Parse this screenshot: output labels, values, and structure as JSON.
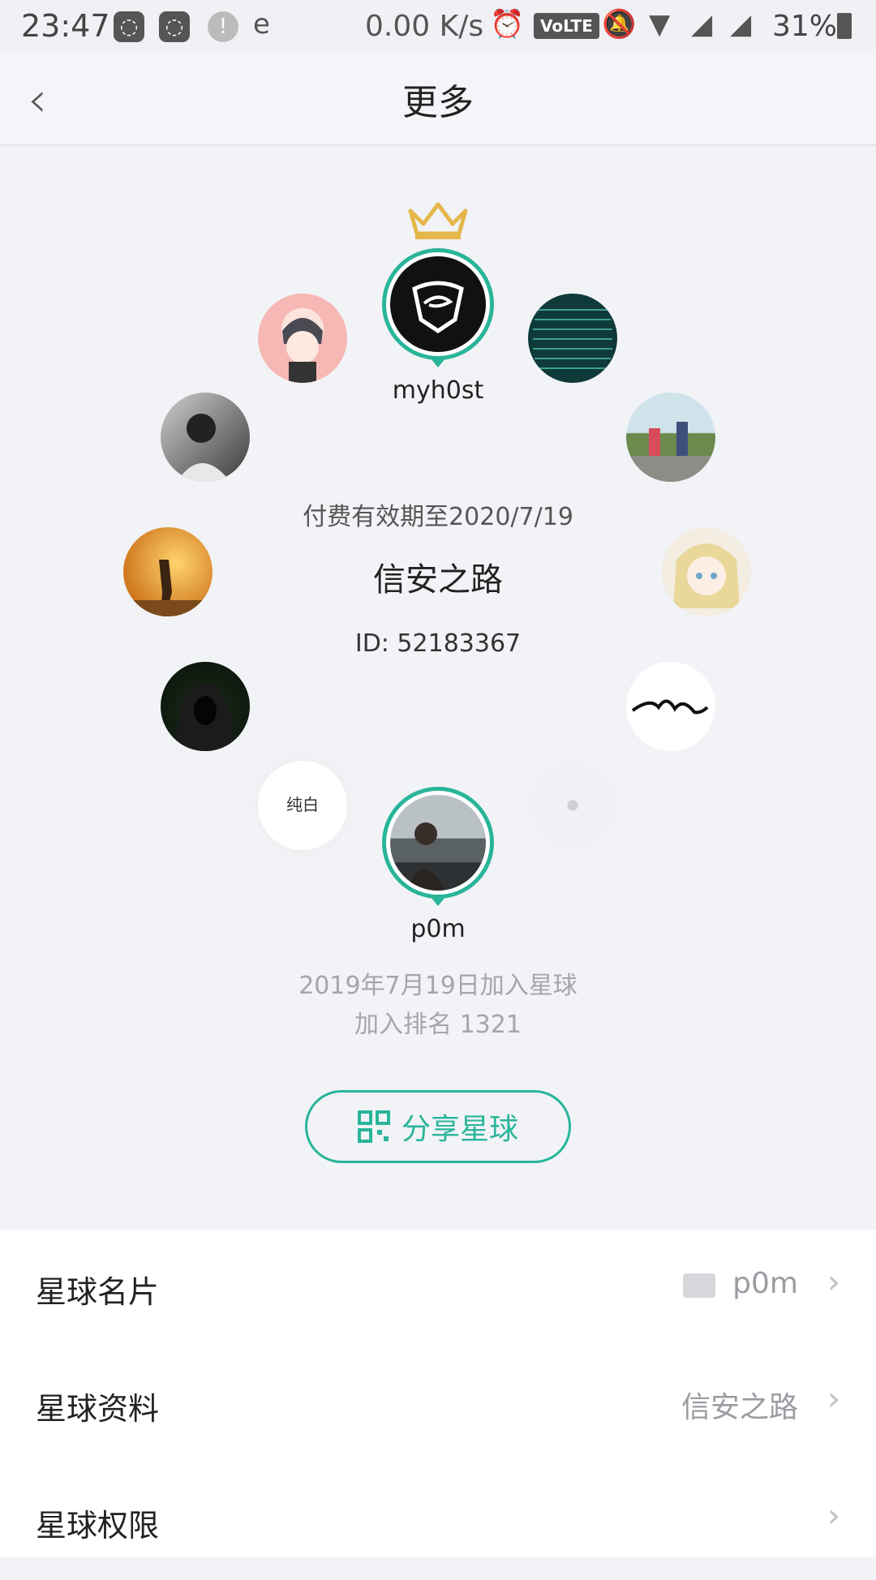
{
  "statusbar": {
    "time": "23:47",
    "speed": "0.00 K/s",
    "volte": "VoLTE",
    "battery": "31%"
  },
  "navbar": {
    "back_icon": "chevron-left-icon",
    "title": "更多"
  },
  "owner": {
    "name": "myh0st",
    "badge_icon": "crown-icon"
  },
  "planet": {
    "paid_until": "付费有效期至2020/7/19",
    "name": "信安之路",
    "id_text": "ID: 52183367"
  },
  "member_avatars": [
    {
      "label": ""
    },
    {
      "label": ""
    },
    {
      "label": ""
    },
    {
      "label": ""
    },
    {
      "label": ""
    },
    {
      "label": ""
    },
    {
      "label": ""
    },
    {
      "label": ""
    },
    {
      "label": "纯白"
    },
    {
      "label": ""
    }
  ],
  "me": {
    "name": "p0m",
    "joined": "2019年7月19日加入星球",
    "rank": "加入排名 1321"
  },
  "share_button": {
    "label": "分享星球",
    "icon": "qrcode-icon"
  },
  "menu": [
    {
      "label": "星球名片",
      "value": "p0m",
      "icon": "id-card-icon"
    },
    {
      "label": "星球资料",
      "value": "信安之路"
    },
    {
      "label": "星球权限",
      "value": ""
    }
  ],
  "colors": {
    "accent": "#29b59a",
    "crown": "#e5b64a"
  }
}
